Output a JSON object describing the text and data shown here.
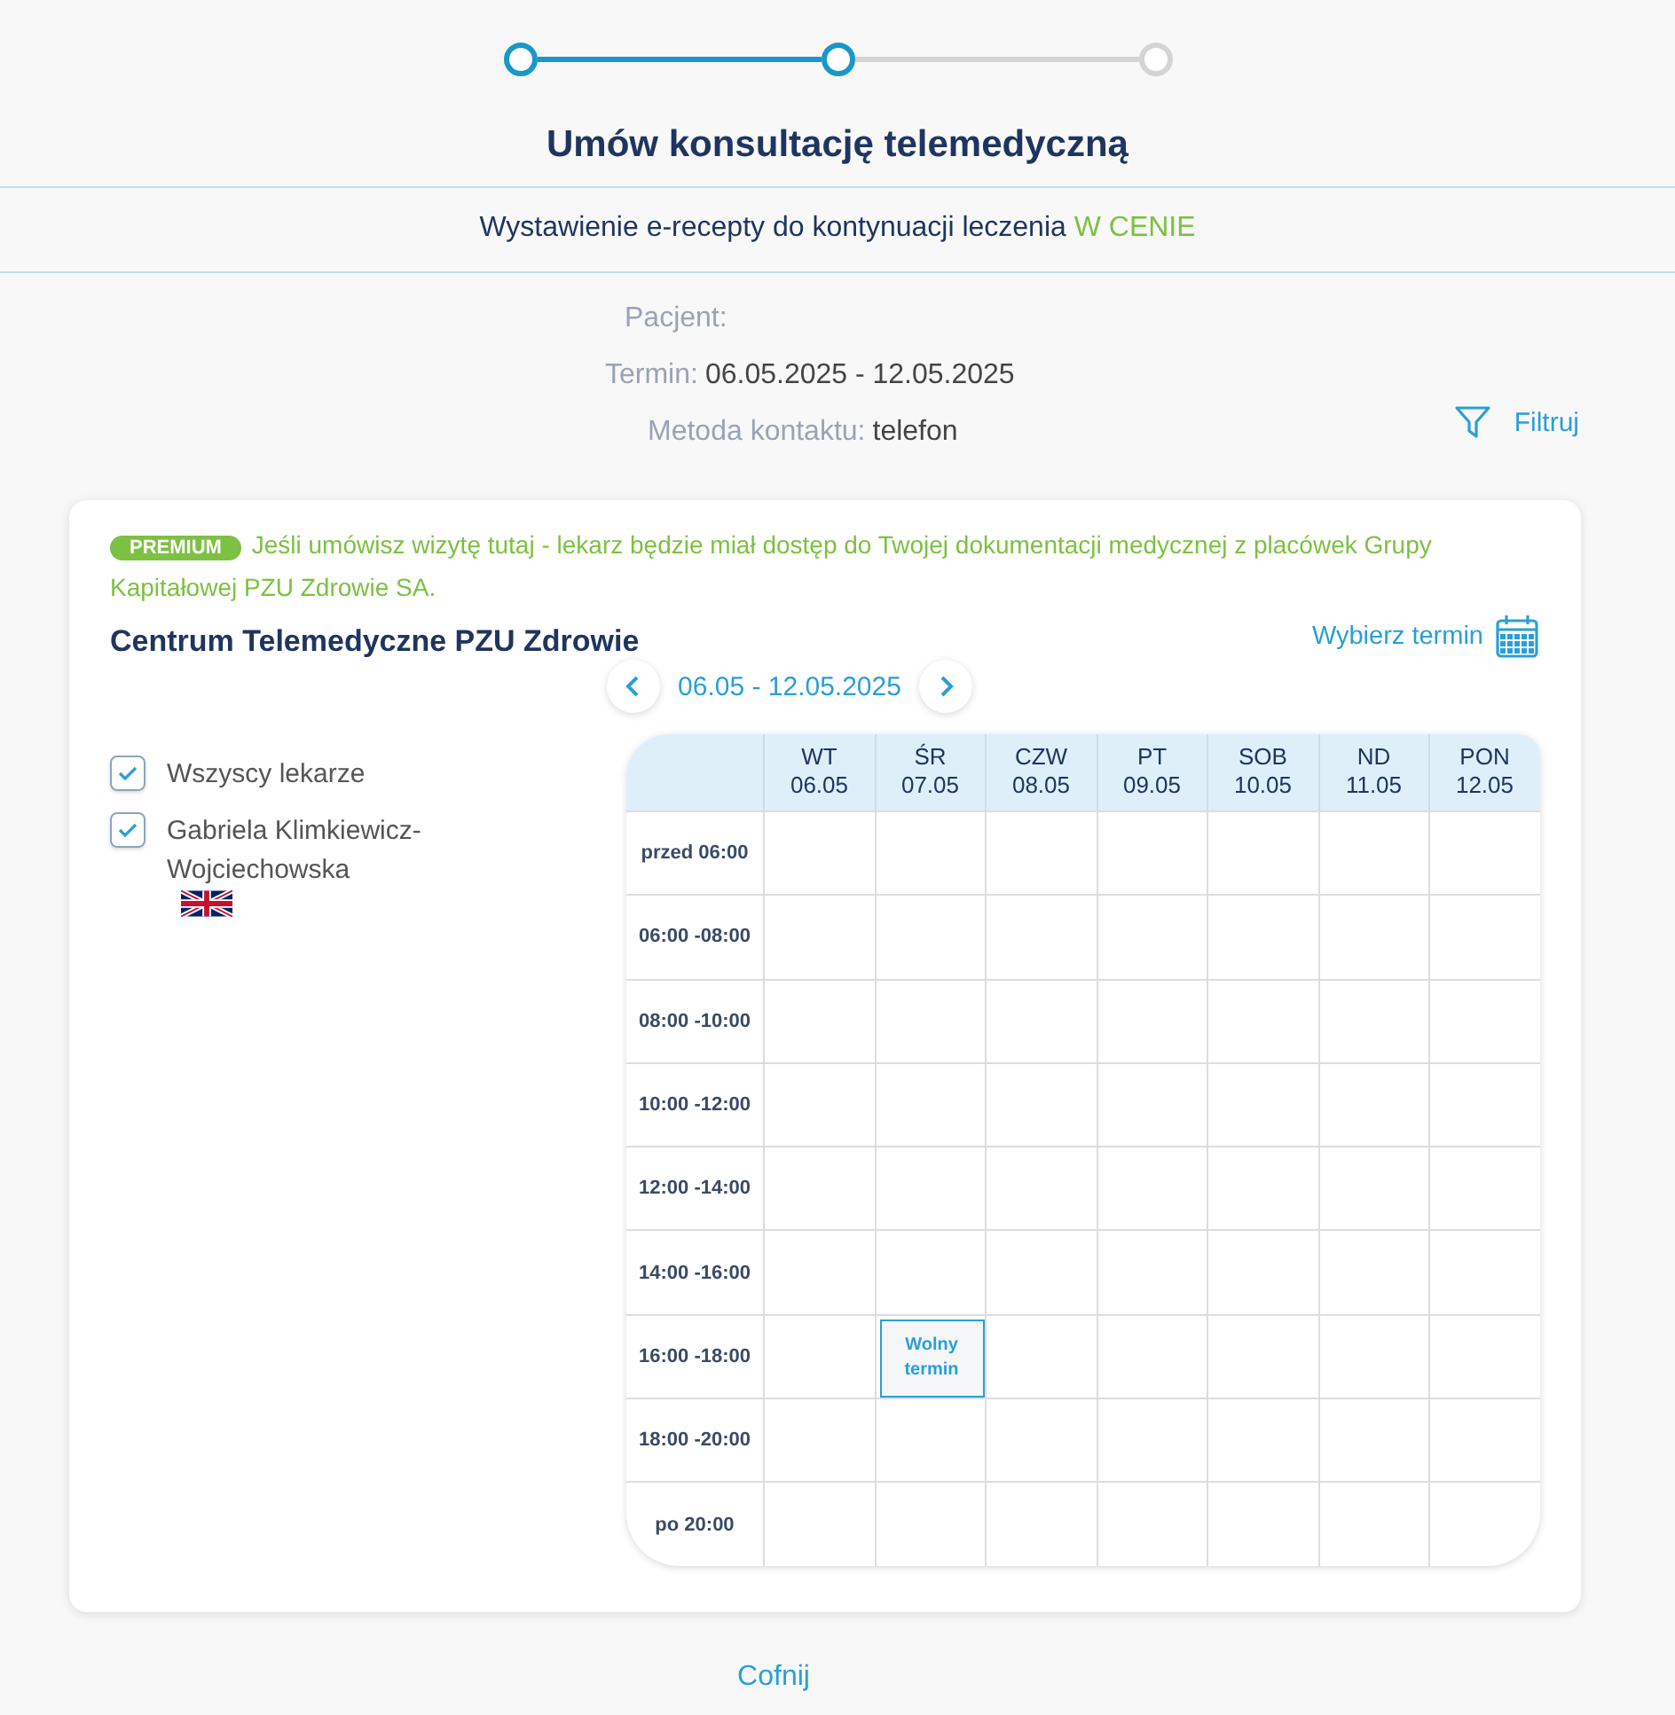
{
  "stepper": [
    {
      "active": true
    },
    {
      "active": true
    },
    {
      "active": false
    }
  ],
  "title": "Umów konsultację telemedyczną",
  "service": {
    "text": "Wystawienie e-recepty do kontynuacji leczenia",
    "highlight": "W CENIE"
  },
  "details": [
    {
      "label": "Pacjent:"
    },
    {
      "label": "Termin:",
      "value": "06.05.2025 - 12.05.2025"
    },
    {
      "label": "Metoda kontaktu:",
      "value": "telefon"
    }
  ],
  "filter_button": "Filtruj",
  "card": {
    "badge": "PREMIUM",
    "notice": "Jeśli umówisz wizytę tutaj - lekarz będzie miał dostęp do Twojej dokumentacji medycznej z placówek Grupy Kapitałowej PZU Zdrowie SA.",
    "facility": "Centrum Telemedyczne PZU Zdrowie",
    "pick_date": "Wybierz termin",
    "week_range": "06.05 - 12.05.2025",
    "doctors": [
      {
        "name": "Wszyscy lekarze",
        "checked": true
      },
      {
        "name": "Gabriela Klimkiewicz-Wojciechowska",
        "checked": true,
        "flag": true
      }
    ],
    "calendar": {
      "days": [
        {
          "day": "WT",
          "date": "06.05"
        },
        {
          "day": "ŚR",
          "date": "07.05"
        },
        {
          "day": "CZW",
          "date": "08.05"
        },
        {
          "day": "PT",
          "date": "09.05"
        },
        {
          "day": "SOB",
          "date": "10.05"
        },
        {
          "day": "ND",
          "date": "11.05"
        },
        {
          "day": "PON",
          "date": "12.05"
        }
      ],
      "rows": [
        {
          "time": "przed 06:00",
          "cells": [
            {
              "free": false
            },
            {
              "free": false
            },
            {
              "free": false
            },
            {
              "free": false
            },
            {
              "free": false
            },
            {
              "free": false
            },
            {
              "free": false
            }
          ]
        },
        {
          "time": "06:00 -08:00",
          "cells": [
            {
              "free": false
            },
            {
              "free": false
            },
            {
              "free": false
            },
            {
              "free": false
            },
            {
              "free": false
            },
            {
              "free": false
            },
            {
              "free": false
            }
          ]
        },
        {
          "time": "08:00 -10:00",
          "cells": [
            {
              "free": false
            },
            {
              "free": false
            },
            {
              "free": false
            },
            {
              "free": false
            },
            {
              "free": false
            },
            {
              "free": false
            },
            {
              "free": false
            }
          ]
        },
        {
          "time": "10:00 -12:00",
          "cells": [
            {
              "free": false
            },
            {
              "free": false
            },
            {
              "free": false
            },
            {
              "free": false
            },
            {
              "free": false
            },
            {
              "free": false
            },
            {
              "free": false
            }
          ]
        },
        {
          "time": "12:00 -14:00",
          "cells": [
            {
              "free": false
            },
            {
              "free": false
            },
            {
              "free": false
            },
            {
              "free": false
            },
            {
              "free": false
            },
            {
              "free": false
            },
            {
              "free": false
            }
          ]
        },
        {
          "time": "14:00 -16:00",
          "cells": [
            {
              "free": false
            },
            {
              "free": false
            },
            {
              "free": false
            },
            {
              "free": false
            },
            {
              "free": false
            },
            {
              "free": false
            },
            {
              "free": false
            }
          ]
        },
        {
          "time": "16:00 -18:00",
          "cells": [
            {
              "free": false
            },
            {
              "free": true,
              "label": "Wolny termin"
            },
            {
              "free": false
            },
            {
              "free": false
            },
            {
              "free": false
            },
            {
              "free": false
            },
            {
              "free": false
            }
          ]
        },
        {
          "time": "18:00 -20:00",
          "cells": [
            {
              "free": false
            },
            {
              "free": false
            },
            {
              "free": false
            },
            {
              "free": false
            },
            {
              "free": false
            },
            {
              "free": false
            },
            {
              "free": false
            }
          ]
        },
        {
          "time": "po 20:00",
          "cells": [
            {
              "free": false
            },
            {
              "free": false
            },
            {
              "free": false
            },
            {
              "free": false
            },
            {
              "free": false
            },
            {
              "free": false
            },
            {
              "free": false
            }
          ]
        }
      ]
    }
  },
  "back_link": "Cofnij"
}
